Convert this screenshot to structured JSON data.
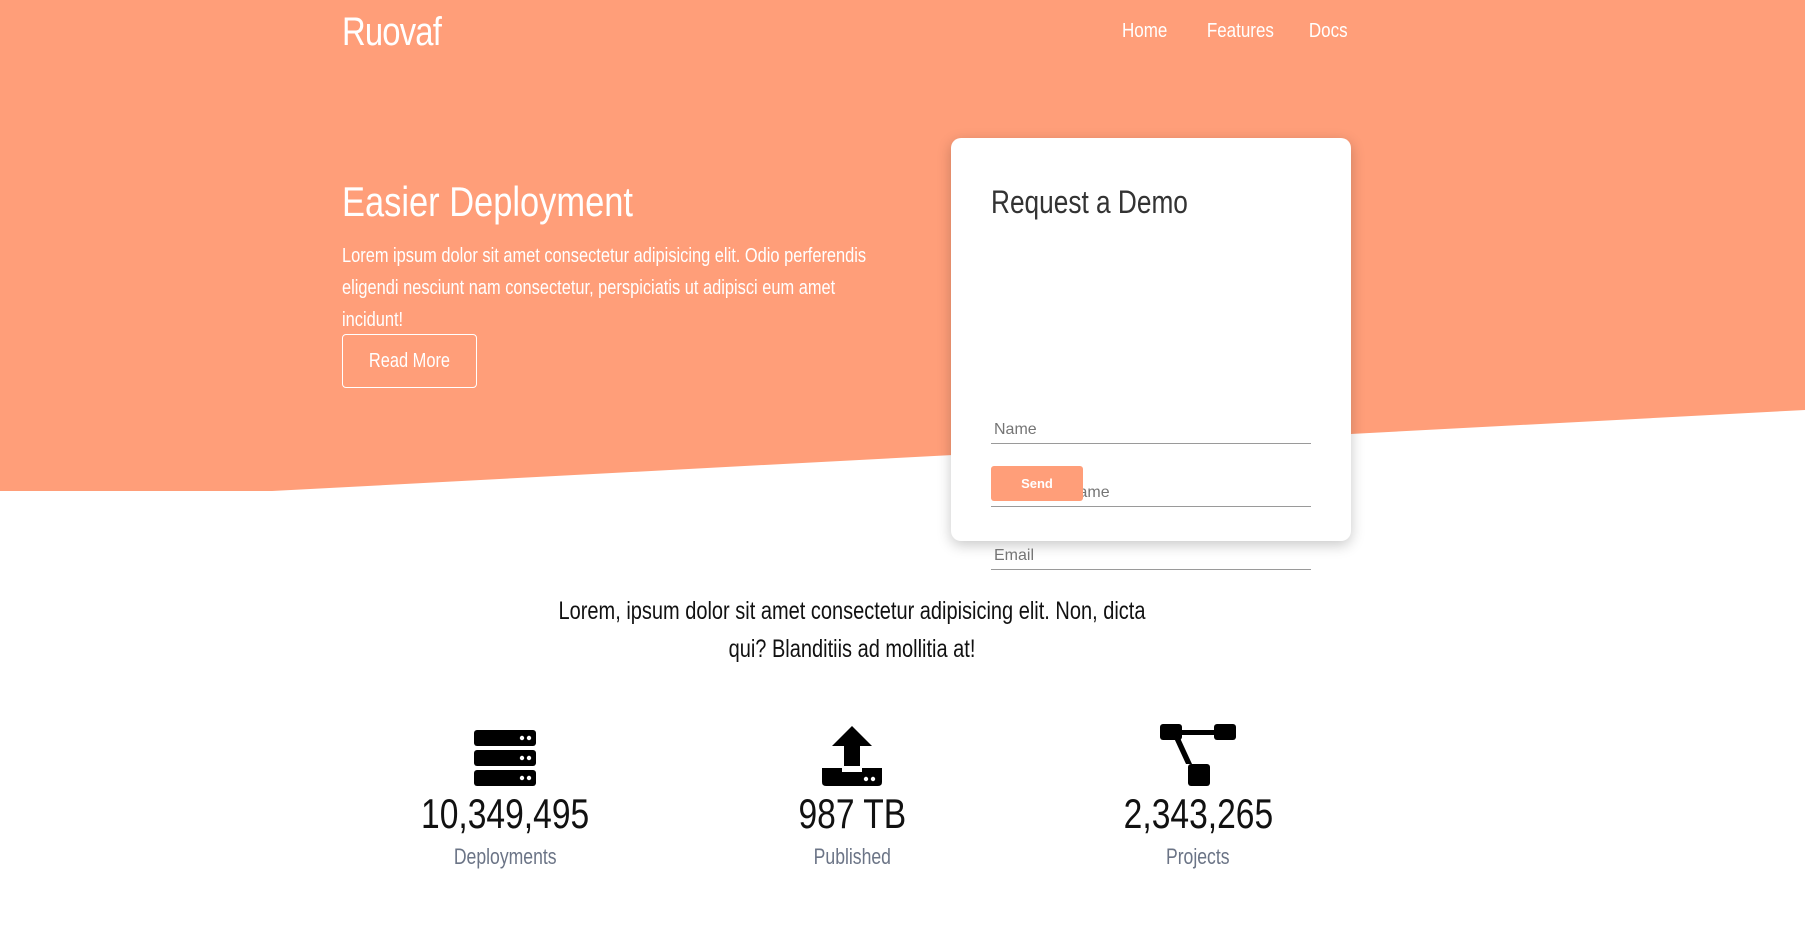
{
  "brand": "Ruovaf",
  "nav": {
    "items": [
      {
        "label": "Home"
      },
      {
        "label": "Features"
      },
      {
        "label": "Docs"
      }
    ]
  },
  "hero": {
    "title": "Easier Deployment",
    "description": "Lorem ipsum dolor sit amet consectetur adipisicing elit. Odio perferendis eligendi nesciunt nam consectetur, perspiciatis ut adipisci eum amet incidunt!",
    "button_label": "Read More"
  },
  "demo_form": {
    "title": "Request a Demo",
    "name_placeholder": "Name",
    "company_placeholder": "Company Name",
    "email_placeholder": "Email",
    "send_label": "Send"
  },
  "lead_text": "Lorem, ipsum dolor sit amet consectetur adipisicing elit. Non, dicta qui? Blanditiis ad mollitia at!",
  "stats": [
    {
      "icon": "server-icon",
      "value": "10,349,495",
      "label": "Deployments"
    },
    {
      "icon": "upload-icon",
      "value": "987 TB",
      "label": "Published"
    },
    {
      "icon": "project-diagram-icon",
      "value": "2,343,265",
      "label": "Projects"
    }
  ],
  "colors": {
    "primary": "#FF9E79",
    "text_dark": "#111111",
    "stat_label": "#6b7486"
  }
}
